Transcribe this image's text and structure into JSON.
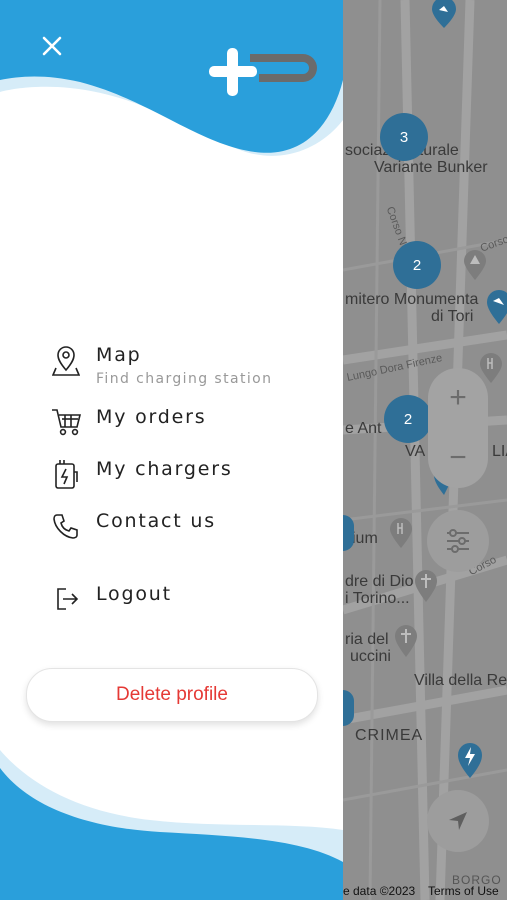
{
  "drawer": {
    "menu": [
      {
        "label": "Map",
        "sublabel": "Find charging station",
        "icon": "map-pin-icon"
      },
      {
        "label": "My orders",
        "icon": "cart-icon"
      },
      {
        "label": "My chargers",
        "icon": "charger-icon"
      },
      {
        "label": "Contact us",
        "icon": "phone-icon"
      },
      {
        "label": "Logout",
        "icon": "logout-icon"
      }
    ],
    "delete_label": "Delete profile",
    "close_icon": "close-icon",
    "logo_icon": "plus-plug-logo"
  },
  "map": {
    "labels": {
      "bunker_1": "sociaz    Culturale",
      "bunker_2": "Variante Bunker",
      "cimitero_1": "mitero Monumenta",
      "cimitero_2": "di Tori",
      "ante": "e Ant",
      "va": "VA",
      "lia": "LIA",
      "ium": "ium",
      "dio_1": "dre di Dio",
      "dio_2": "i Torino...",
      "ria_1": "ria del",
      "ria_2": "uccini",
      "villa": "Villa della Re",
      "crimea": "CRIMEA",
      "borgo": "BORGO",
      "corso_novara": "Corso Novara",
      "lungo_dora": "Lungo Dora Firenze",
      "corso": "Corso",
      "corso_b": "Corso"
    },
    "clusters": {
      "c1": "3",
      "c2": "2",
      "c3": "2"
    },
    "zoom_in": "+",
    "zoom_out": "−",
    "filter_icon": "sliders-icon",
    "locate_icon": "navigation-arrow-icon",
    "footer_data": "e data ©2023",
    "footer_terms": "Terms of Use"
  },
  "colors": {
    "brand_blue": "#2a9fdb",
    "light_blue": "#d6ecf8",
    "delete_red": "#e53935",
    "cluster_blue": "#2f6f97"
  }
}
